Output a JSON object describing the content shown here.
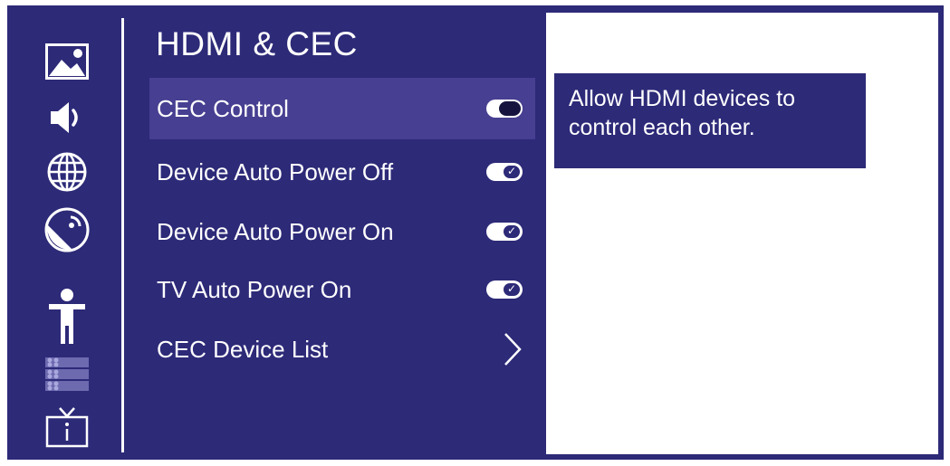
{
  "menu": {
    "title": "HDMI & CEC",
    "items": [
      {
        "label": "CEC Control",
        "control": "toggle",
        "state": "off",
        "selected": true
      },
      {
        "label": "Device Auto Power Off",
        "control": "toggle",
        "state": "on",
        "selected": false
      },
      {
        "label": "Device Auto Power On",
        "control": "toggle",
        "state": "on",
        "selected": false
      },
      {
        "label": "TV Auto Power On",
        "control": "toggle",
        "state": "on",
        "selected": false
      },
      {
        "label": "CEC Device List",
        "control": "chevron",
        "selected": false
      }
    ]
  },
  "rail_icons": [
    "picture-icon",
    "sound-icon",
    "network-icon",
    "satellite-icon",
    "accessibility-icon",
    "channel-list-icon",
    "tv-info-icon"
  ],
  "info": {
    "text": "Allow HDMI devices to control each other."
  },
  "colors": {
    "background": "#2d2a78",
    "selected": "#473f91",
    "panel": "#ffffff"
  }
}
